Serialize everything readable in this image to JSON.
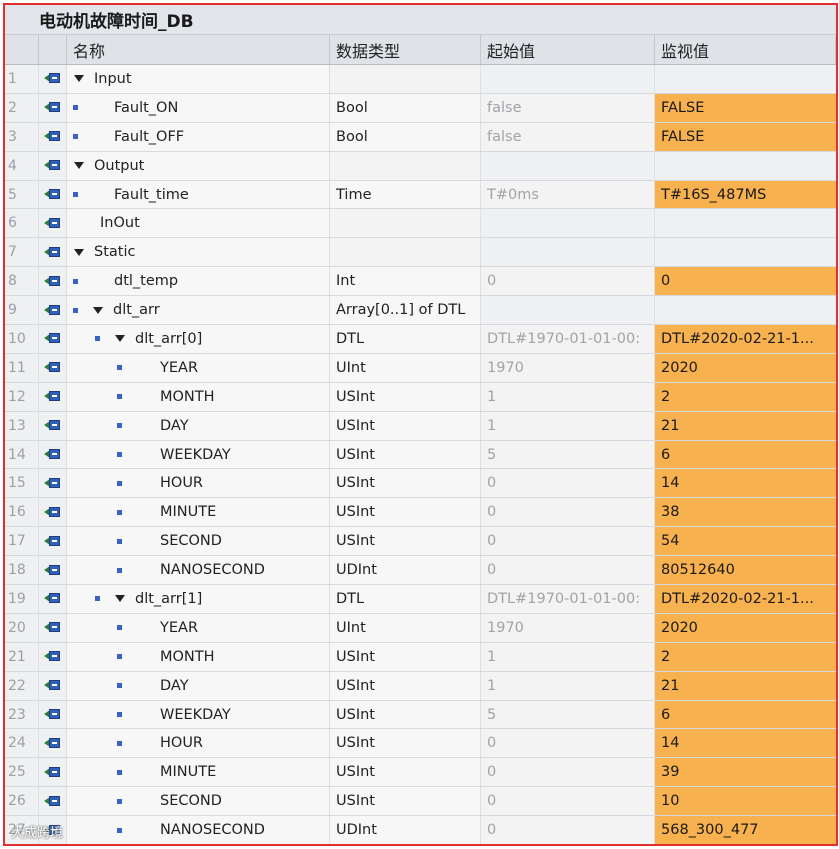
{
  "title": "电动机故障时间_DB",
  "columns": {
    "name": "名称",
    "type": "数据类型",
    "start": "起始值",
    "monitor": "监视值"
  },
  "rows": [
    {
      "num": "1",
      "indent": 0,
      "bullet": false,
      "expander": true,
      "name": "Input",
      "type": "",
      "start": "",
      "monitor": "",
      "hl": false
    },
    {
      "num": "2",
      "indent": 0,
      "bullet": true,
      "expander": false,
      "name": "Fault_ON",
      "type": "Bool",
      "start": "false",
      "monitor": "FALSE",
      "hl": true
    },
    {
      "num": "3",
      "indent": 0,
      "bullet": true,
      "expander": false,
      "name": "Fault_OFF",
      "type": "Bool",
      "start": "false",
      "monitor": "FALSE",
      "hl": true
    },
    {
      "num": "4",
      "indent": 0,
      "bullet": false,
      "expander": true,
      "name": "Output",
      "type": "",
      "start": "",
      "monitor": "",
      "hl": false
    },
    {
      "num": "5",
      "indent": 0,
      "bullet": true,
      "expander": false,
      "name": "Fault_time",
      "type": "Time",
      "start": "T#0ms",
      "monitor": "T#16S_487MS",
      "hl": true
    },
    {
      "num": "6",
      "indent": 0,
      "bullet": false,
      "expander": false,
      "name": "InOut",
      "type": "",
      "start": "",
      "monitor": "",
      "hl": false
    },
    {
      "num": "7",
      "indent": 0,
      "bullet": false,
      "expander": true,
      "name": "Static",
      "type": "",
      "start": "",
      "monitor": "",
      "hl": false
    },
    {
      "num": "8",
      "indent": 0,
      "bullet": true,
      "expander": false,
      "name": "dtl_temp",
      "type": "Int",
      "start": "0",
      "monitor": "0",
      "hl": true
    },
    {
      "num": "9",
      "indent": 0,
      "bullet": true,
      "expander": true,
      "name": "dlt_arr",
      "type": "Array[0..1] of DTL",
      "start": "",
      "monitor": "",
      "hl": false
    },
    {
      "num": "10",
      "indent": 1,
      "bullet": true,
      "expander": true,
      "name": "dlt_arr[0]",
      "type": "DTL",
      "start": "DTL#1970-01-01-00:",
      "monitor": "DTL#2020-02-21-1...",
      "hl": true
    },
    {
      "num": "11",
      "indent": 2,
      "bullet": true,
      "expander": false,
      "name": "YEAR",
      "type": "UInt",
      "start": "1970",
      "monitor": "2020",
      "hl": true
    },
    {
      "num": "12",
      "indent": 2,
      "bullet": true,
      "expander": false,
      "name": "MONTH",
      "type": "USInt",
      "start": "1",
      "monitor": "2",
      "hl": true
    },
    {
      "num": "13",
      "indent": 2,
      "bullet": true,
      "expander": false,
      "name": "DAY",
      "type": "USInt",
      "start": "1",
      "monitor": "21",
      "hl": true
    },
    {
      "num": "14",
      "indent": 2,
      "bullet": true,
      "expander": false,
      "name": "WEEKDAY",
      "type": "USInt",
      "start": "5",
      "monitor": "6",
      "hl": true
    },
    {
      "num": "15",
      "indent": 2,
      "bullet": true,
      "expander": false,
      "name": "HOUR",
      "type": "USInt",
      "start": "0",
      "monitor": "14",
      "hl": true
    },
    {
      "num": "16",
      "indent": 2,
      "bullet": true,
      "expander": false,
      "name": "MINUTE",
      "type": "USInt",
      "start": "0",
      "monitor": "38",
      "hl": true
    },
    {
      "num": "17",
      "indent": 2,
      "bullet": true,
      "expander": false,
      "name": "SECOND",
      "type": "USInt",
      "start": "0",
      "monitor": "54",
      "hl": true
    },
    {
      "num": "18",
      "indent": 2,
      "bullet": true,
      "expander": false,
      "name": "NANOSECOND",
      "type": "UDInt",
      "start": "0",
      "monitor": "80512640",
      "hl": true
    },
    {
      "num": "19",
      "indent": 1,
      "bullet": true,
      "expander": true,
      "name": "dlt_arr[1]",
      "type": "DTL",
      "start": "DTL#1970-01-01-00:",
      "monitor": "DTL#2020-02-21-1...",
      "hl": true
    },
    {
      "num": "20",
      "indent": 2,
      "bullet": true,
      "expander": false,
      "name": "YEAR",
      "type": "UInt",
      "start": "1970",
      "monitor": "2020",
      "hl": true
    },
    {
      "num": "21",
      "indent": 2,
      "bullet": true,
      "expander": false,
      "name": "MONTH",
      "type": "USInt",
      "start": "1",
      "monitor": "2",
      "hl": true
    },
    {
      "num": "22",
      "indent": 2,
      "bullet": true,
      "expander": false,
      "name": "DAY",
      "type": "USInt",
      "start": "1",
      "monitor": "21",
      "hl": true
    },
    {
      "num": "23",
      "indent": 2,
      "bullet": true,
      "expander": false,
      "name": "WEEKDAY",
      "type": "USInt",
      "start": "5",
      "monitor": "6",
      "hl": true
    },
    {
      "num": "24",
      "indent": 2,
      "bullet": true,
      "expander": false,
      "name": "HOUR",
      "type": "USInt",
      "start": "0",
      "monitor": "14",
      "hl": true
    },
    {
      "num": "25",
      "indent": 2,
      "bullet": true,
      "expander": false,
      "name": "MINUTE",
      "type": "USInt",
      "start": "0",
      "monitor": "39",
      "hl": true
    },
    {
      "num": "26",
      "indent": 2,
      "bullet": true,
      "expander": false,
      "name": "SECOND",
      "type": "USInt",
      "start": "0",
      "monitor": "10",
      "hl": true
    },
    {
      "num": "27",
      "indent": 2,
      "bullet": true,
      "expander": false,
      "name": "NANOSECOND",
      "type": "UDInt",
      "start": "0",
      "monitor": "568_300_477",
      "hl": true
    }
  ],
  "watermark": "大成跨境",
  "colors": {
    "highlight": "#f7b14e",
    "frame_border": "#e03030",
    "icon_blue": "#2f5fb8",
    "icon_green": "#2a7d3c"
  },
  "icons": {
    "row_icon": "interface-io-icon",
    "expander": "triangle-down-icon",
    "bullet": "square-bullet-icon"
  }
}
